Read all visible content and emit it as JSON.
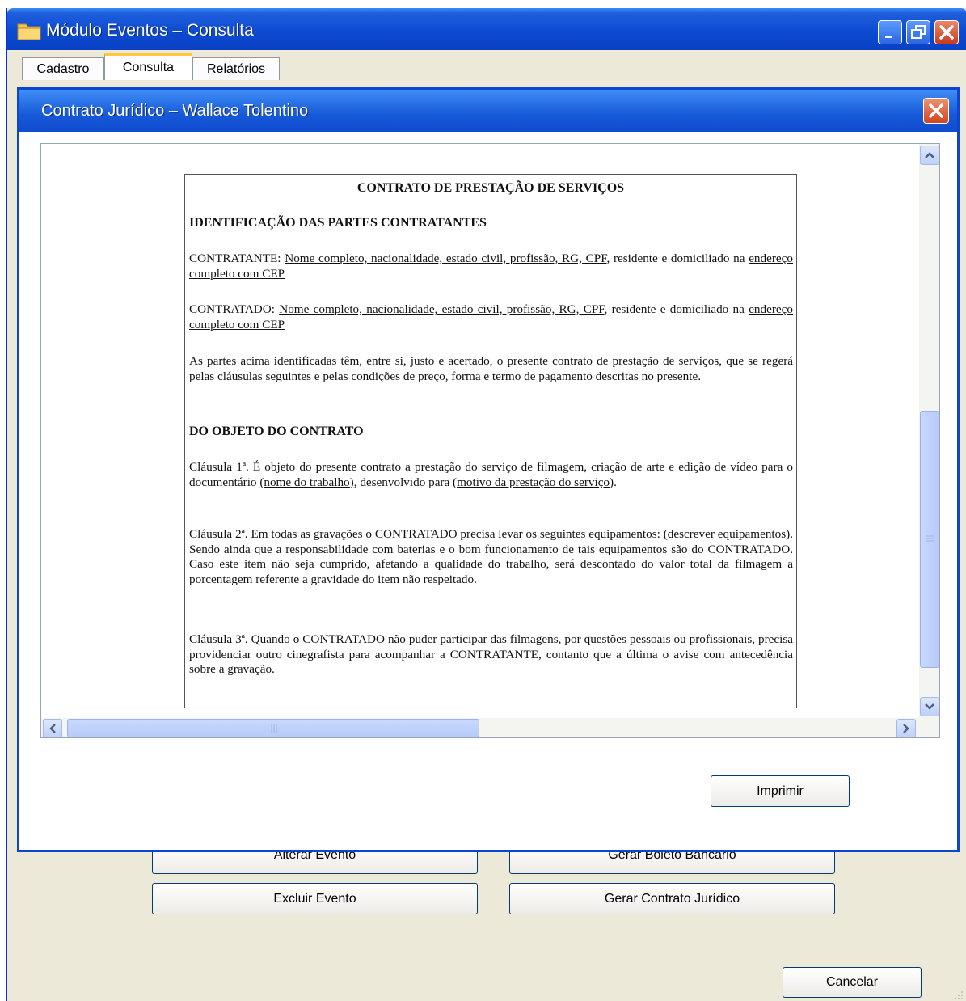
{
  "window": {
    "title": "Módulo Eventos – Consulta"
  },
  "tabs": [
    {
      "label": "Cadastro"
    },
    {
      "label": "Consulta"
    },
    {
      "label": "Relatórios"
    }
  ],
  "dialog": {
    "title": "Contrato Jurídico – Wallace Tolentino",
    "print_label": "Imprimir"
  },
  "document": {
    "title": "CONTRATO DE PRESTAÇÃO DE SERVIÇOS",
    "section1": "IDENTIFICAÇÃO DAS PARTES CONTRATANTES",
    "contratante_prefix": "CONTRATANTE: ",
    "contratante_fields": "Nome completo, nacionalidade, estado civil, profissão, RG, CPF",
    "contratante_mid": ", residente e domiciliado na ",
    "contratante_addr": "endereço completo com CEP",
    "contratado_prefix": "CONTRATADO: ",
    "contratado_fields": "Nome completo, nacionalidade, estado civil, profissão, RG, CPF",
    "contratado_mid": ", residente e domiciliado na ",
    "contratado_addr": "endereço completo com CEP",
    "intro": "As partes acima identificadas têm, entre si, justo e acertado, o presente contrato de prestação de serviços, que se regerá pelas cláusulas seguintes e pelas condições de preço, forma e termo de pagamento descritas no presente.",
    "section2": "DO OBJETO DO CONTRATO",
    "c1_a": "Cláusula 1ª. É objeto do presente contrato a prestação do serviço de filmagem, criação de arte e edição de vídeo para o documentário ",
    "c1_u1": "(nome do trabalho)",
    "c1_b": ", desenvolvido para ",
    "c1_u2": "(motivo da prestação do serviço)",
    "c1_c": ".",
    "c2_a": "Cláusula 2ª. Em todas as gravações o CONTRATADO precisa levar os seguintes equipamentos: ",
    "c2_u": "(descrever equipamentos)",
    "c2_b": ". Sendo ainda que a responsabilidade com baterias e o bom funcionamento de tais equipamentos são do CONTRATADO. Caso este item não seja cumprido, afetando a qualidade do trabalho, será descontado do valor total da filmagem a porcentagem referente a gravidade do item não respeitado.",
    "c3": "Cláusula 3ª. Quando o CONTRATADO não puder participar das filmagens, por questões pessoais ou profissionais, precisa providenciar outro cinegrafista para acompanhar a CONTRATANTE, contanto que a última o avise com antecedência sobre a gravação."
  },
  "actions": {
    "alterar": "Alterar Evento",
    "boleto": "Gerar Boleto Bancário",
    "excluir": "Excluir Evento",
    "contrato": "Gerar Contrato Jurídico",
    "cancelar": "Cancelar"
  },
  "colors": {
    "titlebar": "#0d4bd1",
    "window_bg": "#ece9d8",
    "active_tab_accent": "#ffc83c"
  }
}
